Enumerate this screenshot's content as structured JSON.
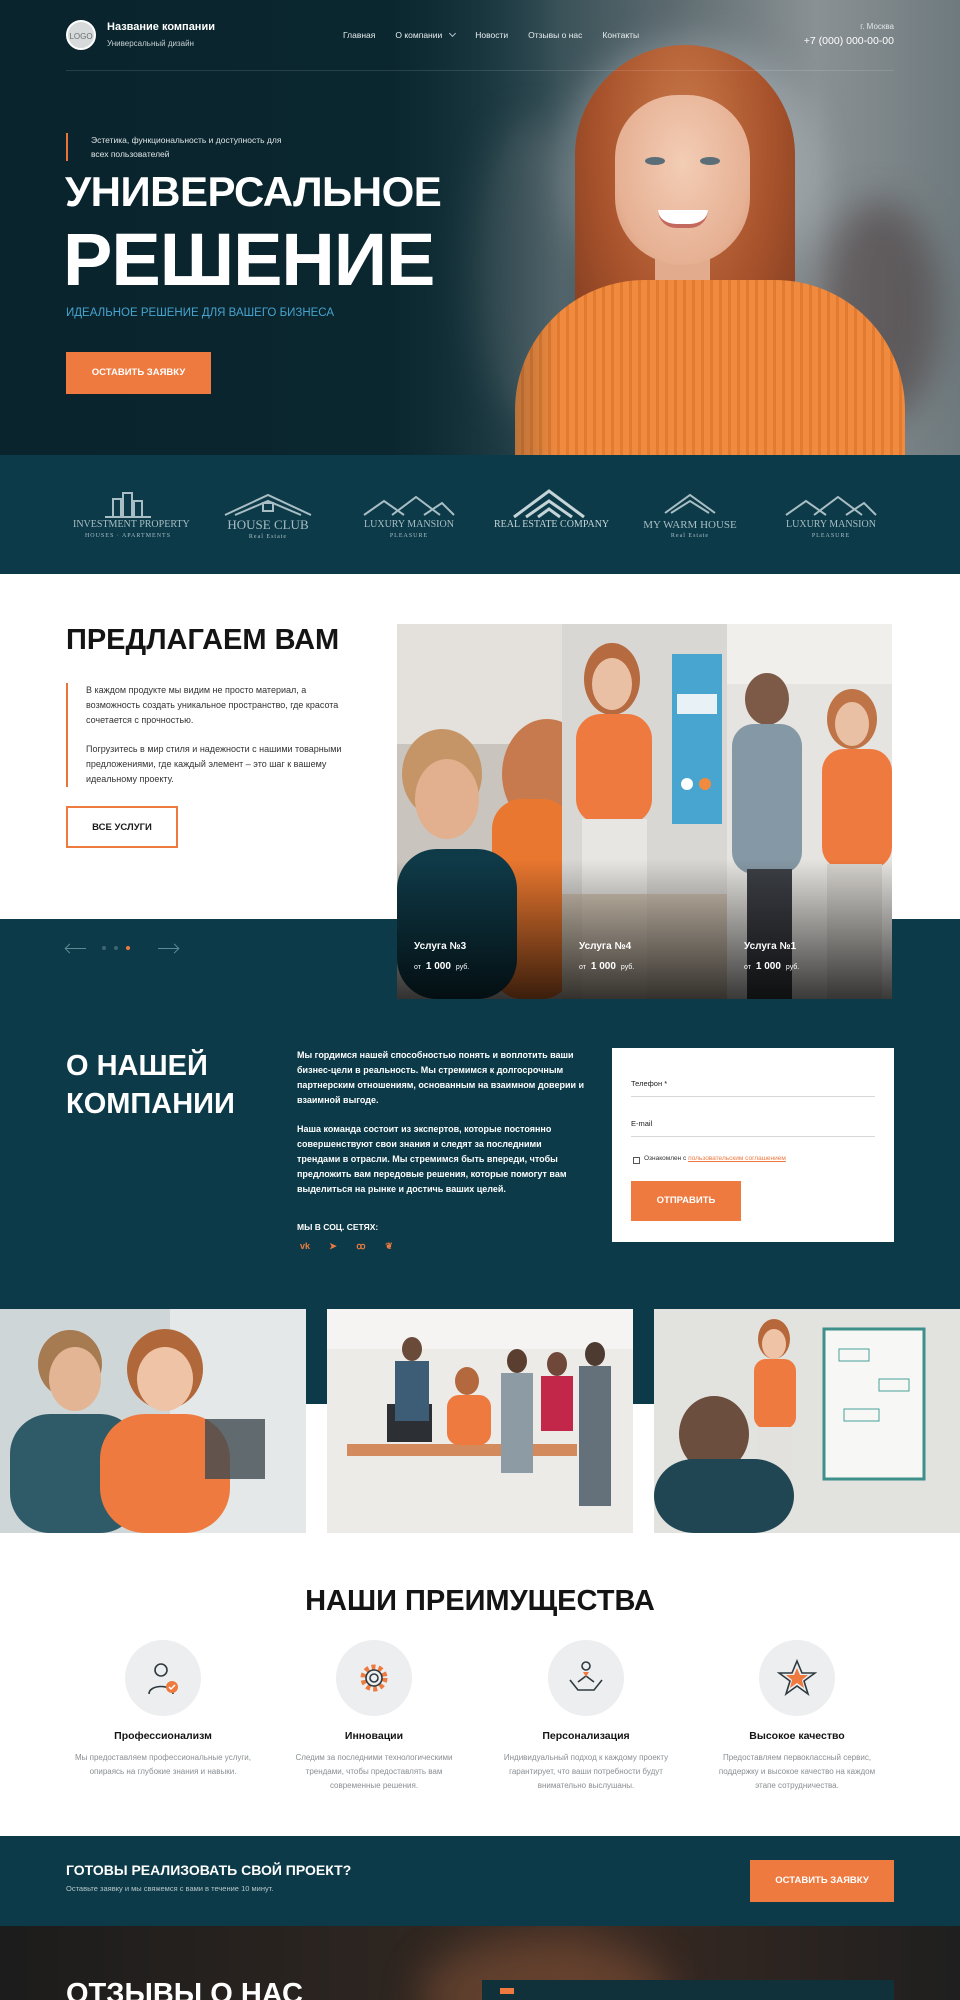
{
  "header": {
    "logo_text": "LOGO",
    "company_name": "Название компании",
    "company_sub": "Универсальный дизайн",
    "nav": [
      "Главная",
      "О компании",
      "Новости",
      "Отзывы о нас",
      "Контакты"
    ],
    "city": "г. Москва",
    "phone": "+7 (000) 000-00-00"
  },
  "hero": {
    "tagline": "Эстетика, функциональность и доступность для всех пользователей",
    "title_line1": "УНИВЕРСАЛЬНОЕ",
    "title_line2": "РЕШЕНИЕ",
    "subtitle": "ИДЕАЛЬНОЕ РЕШЕНИЕ ДЛЯ ВАШЕГО БИЗНЕСА",
    "button": "ОСТАВИТЬ ЗАЯВКУ"
  },
  "partners": [
    {
      "name": "INVESTMENT PROPERTY",
      "sub": "HOUSES · APARTMENTS"
    },
    {
      "name": "HOUSE CLUB",
      "sub": "Real Estate"
    },
    {
      "name": "LUXURY MANSION",
      "sub": "PLEASURE"
    },
    {
      "name": "REAL ESTATE COMPANY",
      "sub": ""
    },
    {
      "name": "MY WARM HOUSE",
      "sub": "Real Estate"
    },
    {
      "name": "LUXURY MANSION",
      "sub": "PLEASURE"
    }
  ],
  "offer": {
    "title": "ПРЕДЛАГАЕМ ВАМ",
    "paragraph1": "В каждом продукте мы видим не просто материал, а возможность создать уникальное пространство, где красота сочетается с прочностью.",
    "paragraph2": "Погрузитесь в мир стиля и надежности с нашими товарными предложениями, где каждый элемент – это шаг к вашему идеальному проекту.",
    "button": "ВСЕ УСЛУГИ",
    "cards": [
      {
        "title": "Услуга №3",
        "price_prefix": "от",
        "price": "1 000",
        "currency": "руб."
      },
      {
        "title": "Услуга №4",
        "price_prefix": "от",
        "price": "1 000",
        "currency": "руб."
      },
      {
        "title": "Услуга №1",
        "price_prefix": "от",
        "price": "1 000",
        "currency": "руб."
      }
    ]
  },
  "about": {
    "title_line1": "О НАШЕЙ",
    "title_line2": "КОМПАНИИ",
    "paragraph1": "Мы гордимся нашей способностью понять и воплотить ваши бизнес-цели в реальность. Мы стремимся к долгосрочным партнерским отношениям, основанным на взаимном доверии и взаимной выгоде.",
    "paragraph2": "Наша команда состоит из экспертов, которые постоянно совершенствуют свои знания и следят за последними трендами в отрасли. Мы стремимся быть впереди, чтобы предложить вам передовые решения, которые помогут вам выделиться на рынке и достичь ваших целей.",
    "social_label": "МЫ В СОЦ. СЕТЯХ:",
    "social": [
      "vk",
      "telegram",
      "odnoklassniki",
      "twitter"
    ],
    "social_glyphs": [
      "vk",
      "➤",
      "ꝏ",
      "❦"
    ],
    "form": {
      "phone_label": "Телефон *",
      "email_label": "E-mail",
      "consent_text": "Ознакомлен с ",
      "consent_link": "пользовательским соглашением",
      "submit": "ОТПРАВИТЬ"
    }
  },
  "advantages": {
    "title": "НАШИ ПРЕИМУЩЕСТВА",
    "items": [
      {
        "icon": "professional-icon",
        "name": "Профессионализм",
        "desc": "Мы предоставляем профессиональные услуги, опираясь на глубокие знания и навыки."
      },
      {
        "icon": "gear-icon",
        "name": "Инновации",
        "desc": "Следим за последними технологическими трендами, чтобы предоставлять вам современные решения."
      },
      {
        "icon": "handshake-icon",
        "name": "Персонализация",
        "desc": "Индивидуальный подход к каждому проекту гарантирует, что ваши потребности будут внимательно выслушаны."
      },
      {
        "icon": "star-icon",
        "name": "Высокое качество",
        "desc": "Предоставляем первоклассный сервис, поддержку и высокое качество на каждом этапе сотрудничества."
      }
    ]
  },
  "cta": {
    "title": "ГОТОВЫ РЕАЛИЗОВАТЬ СВОЙ ПРОЕКТ?",
    "subtitle": "Оставьте заявку и мы свяжемся с вами в течение 10 минут.",
    "button": "ОСТАВИТЬ ЗАЯВКУ"
  },
  "reviews": {
    "title": "ОТЗЫВЫ О НАС"
  },
  "colors": {
    "primary_dark": "#0c3a48",
    "accent": "#ee7a3f",
    "link_blue": "#47a3cf"
  }
}
